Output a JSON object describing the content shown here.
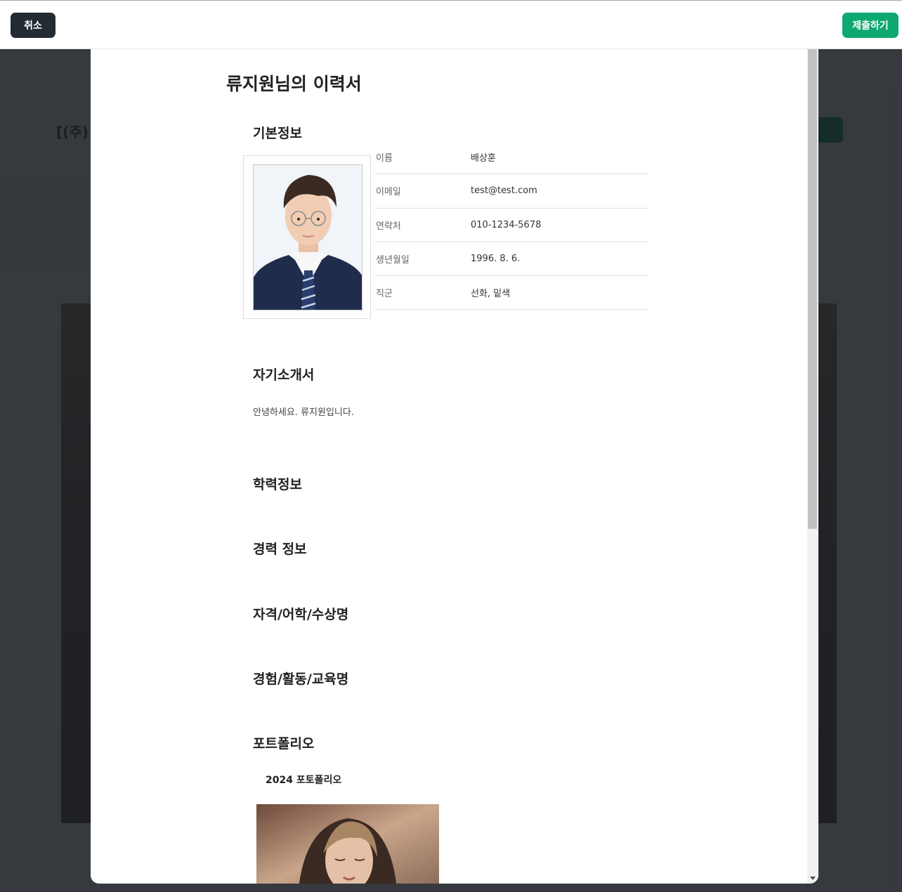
{
  "toolbar": {
    "cancel_label": "취소",
    "submit_label": "제출하기"
  },
  "resume": {
    "title": "류지원님의 이력서",
    "basic_info": {
      "heading": "기본정보",
      "rows": [
        {
          "label": "이름",
          "value": "배상훈"
        },
        {
          "label": "이메일",
          "value": "test@test.com"
        },
        {
          "label": "연락처",
          "value": "010-1234-5678"
        },
        {
          "label": "생년월일",
          "value": "1996. 8. 6."
        },
        {
          "label": "직군",
          "value": "선화, 밑색"
        }
      ]
    },
    "self_intro": {
      "heading": "자기소개서",
      "text": "안녕하세요. 류지원입니다."
    },
    "education": {
      "heading": "학력정보"
    },
    "career": {
      "heading": "경력 정보"
    },
    "certificates": {
      "heading": "자격/어학/수상명"
    },
    "activities": {
      "heading": "경험/활동/교육명"
    },
    "portfolio": {
      "heading": "포트폴리오",
      "items": [
        {
          "name": "2024 포토폴리오"
        }
      ]
    }
  }
}
